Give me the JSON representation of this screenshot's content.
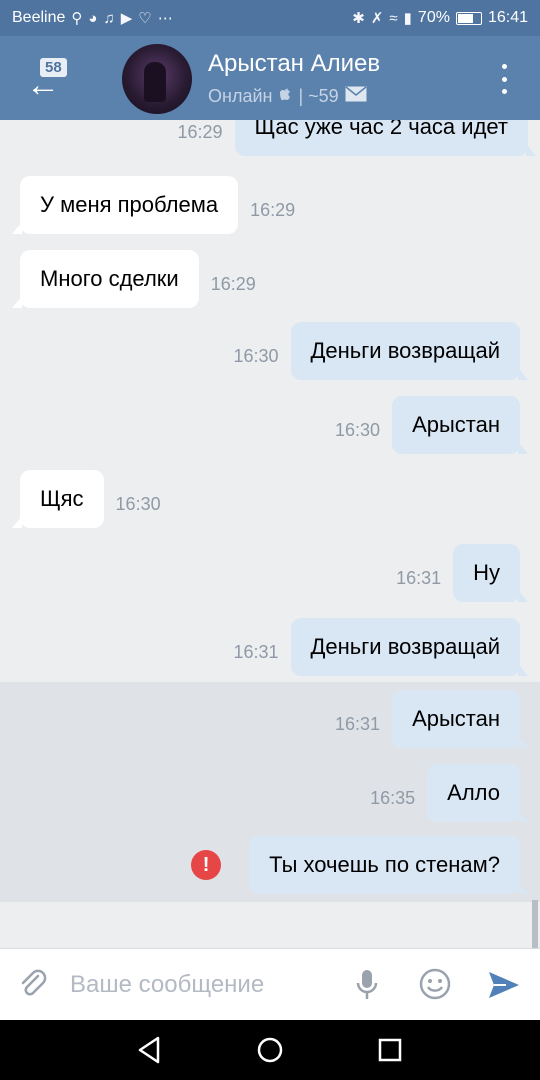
{
  "status_bar": {
    "carrier": "Beeline",
    "battery_percent": "70%",
    "battery_level": 0.7,
    "time": "16:41"
  },
  "header": {
    "back_badge": "58",
    "contact_name": "Арыстан Алиев",
    "status": "Онлайн",
    "status_extra": "| ~59",
    "accent": "#5b81ad"
  },
  "messages": [
    {
      "dir": "out",
      "text": "Щас уже час 2 часа идет",
      "time": "16:29"
    },
    {
      "dir": "in",
      "text": "У меня проблема",
      "time": "16:29"
    },
    {
      "dir": "in",
      "text": "Много сделки",
      "time": "16:29"
    },
    {
      "dir": "out",
      "text": "Деньги возвращай",
      "time": "16:30"
    },
    {
      "dir": "out",
      "text": "Арыстан",
      "time": "16:30"
    },
    {
      "dir": "in",
      "text": "Щяс",
      "time": "16:30"
    },
    {
      "dir": "out",
      "text": "Ну",
      "time": "16:31"
    },
    {
      "dir": "out",
      "text": "Деньги возвращай",
      "time": "16:31"
    },
    {
      "dir": "out",
      "text": "Арыстан",
      "time": "16:31"
    },
    {
      "dir": "out",
      "text": "Алло",
      "time": "16:35"
    },
    {
      "dir": "out",
      "text": "Ты хочешь по стенам?",
      "time": "",
      "error": true
    }
  ],
  "composer": {
    "placeholder": "Ваше сообщение",
    "send_color": "#5181b8"
  },
  "icons": [
    "back-arrow-icon",
    "apple-icon",
    "mail-icon",
    "more-icon",
    "error-icon",
    "attach-icon",
    "mic-icon",
    "emoji-icon",
    "send-icon",
    "nav-back-icon",
    "nav-home-icon",
    "nav-recents-icon"
  ]
}
